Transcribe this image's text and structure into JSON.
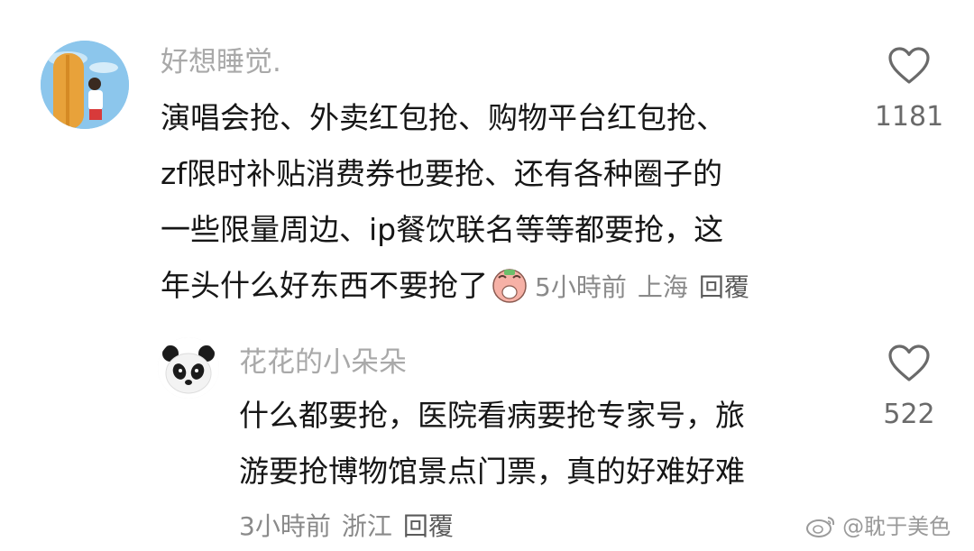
{
  "comments": [
    {
      "username": "好想睡觉.",
      "lines": [
        "演唱会抢、外卖红包抢、购物平台红包抢、",
        "zf限时补贴消费券也要抢、还有各种圈子的",
        "一些限量周边、ip餐饮联名等等都要抢，这",
        "年头什么好东西不要抢了"
      ],
      "emoji": "crying-face-emoji",
      "time": "5小時前",
      "location": "上海",
      "reply_label": "回覆",
      "likes": "1181"
    },
    {
      "username": "花花的小朵朵",
      "lines": [
        "什么都要抢，医院看病要抢专家号，旅",
        "游要抢博物馆景点门票，真的好难好难"
      ],
      "time": "3小時前",
      "location": "浙江",
      "reply_label": "回覆",
      "likes": "522"
    }
  ],
  "watermark": {
    "icon": "weibo-icon",
    "text": "@耽于美色"
  },
  "colors": {
    "text": "#161616",
    "username": "#a9a9a9",
    "meta": "#8a8a8a"
  }
}
